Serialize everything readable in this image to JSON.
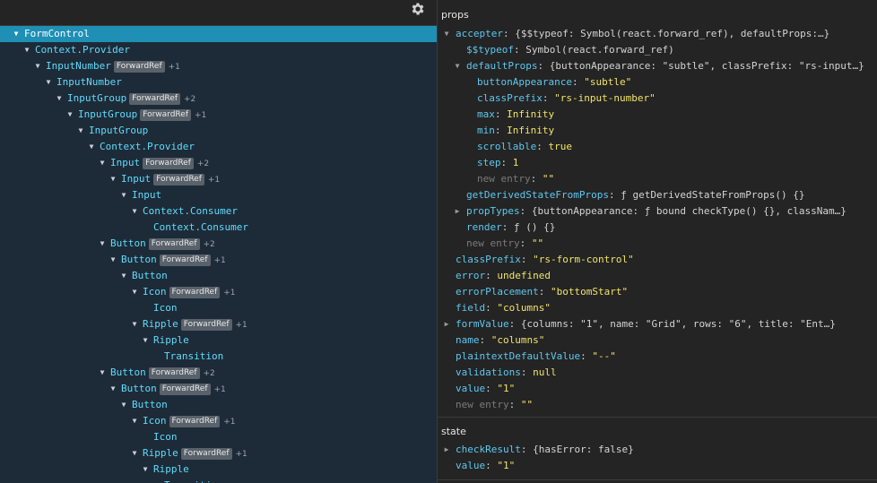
{
  "toolbar": {
    "settings_icon": "gear-icon"
  },
  "tree": [
    {
      "label": "FormControl",
      "depth": 0,
      "expanded": true,
      "selected": true
    },
    {
      "label": "Context.Provider",
      "depth": 1,
      "expanded": true
    },
    {
      "label": "InputNumber",
      "depth": 2,
      "expanded": true,
      "badge": "ForwardRef",
      "count": "+1"
    },
    {
      "label": "InputNumber",
      "depth": 3,
      "expanded": true
    },
    {
      "label": "InputGroup",
      "depth": 4,
      "expanded": true,
      "badge": "ForwardRef",
      "count": "+2"
    },
    {
      "label": "InputGroup",
      "depth": 5,
      "expanded": true,
      "badge": "ForwardRef",
      "count": "+1"
    },
    {
      "label": "InputGroup",
      "depth": 6,
      "expanded": true
    },
    {
      "label": "Context.Provider",
      "depth": 7,
      "expanded": true
    },
    {
      "label": "Input",
      "depth": 8,
      "expanded": true,
      "badge": "ForwardRef",
      "count": "+2"
    },
    {
      "label": "Input",
      "depth": 9,
      "expanded": true,
      "badge": "ForwardRef",
      "count": "+1"
    },
    {
      "label": "Input",
      "depth": 10,
      "expanded": true
    },
    {
      "label": "Context.Consumer",
      "depth": 11,
      "expanded": true
    },
    {
      "label": "Context.Consumer",
      "depth": 12
    },
    {
      "label": "Button",
      "depth": 8,
      "expanded": true,
      "badge": "ForwardRef",
      "count": "+2"
    },
    {
      "label": "Button",
      "depth": 9,
      "expanded": true,
      "badge": "ForwardRef",
      "count": "+1"
    },
    {
      "label": "Button",
      "depth": 10,
      "expanded": true
    },
    {
      "label": "Icon",
      "depth": 11,
      "expanded": true,
      "badge": "ForwardRef",
      "count": "+1"
    },
    {
      "label": "Icon",
      "depth": 12
    },
    {
      "label": "Ripple",
      "depth": 11,
      "expanded": true,
      "badge": "ForwardRef",
      "count": "+1"
    },
    {
      "label": "Ripple",
      "depth": 12,
      "expanded": true
    },
    {
      "label": "Transition",
      "depth": 13
    },
    {
      "label": "Button",
      "depth": 8,
      "expanded": true,
      "badge": "ForwardRef",
      "count": "+2"
    },
    {
      "label": "Button",
      "depth": 9,
      "expanded": true,
      "badge": "ForwardRef",
      "count": "+1"
    },
    {
      "label": "Button",
      "depth": 10,
      "expanded": true
    },
    {
      "label": "Icon",
      "depth": 11,
      "expanded": true,
      "badge": "ForwardRef",
      "count": "+1"
    },
    {
      "label": "Icon",
      "depth": 12
    },
    {
      "label": "Ripple",
      "depth": 11,
      "expanded": true,
      "badge": "ForwardRef",
      "count": "+1"
    },
    {
      "label": "Ripple",
      "depth": 12,
      "expanded": true
    },
    {
      "label": "Transition",
      "depth": 13
    }
  ],
  "props": {
    "title": "props",
    "rows": [
      {
        "depth": 0,
        "toggle": "down",
        "key": "accepter",
        "value": "{$$typeof: Symbol(react.forward_ref), defaultProps:…}",
        "type": "obj"
      },
      {
        "depth": 1,
        "key": "$$typeof",
        "value": "Symbol(react.forward_ref)",
        "type": "obj"
      },
      {
        "depth": 1,
        "toggle": "down",
        "key": "defaultProps",
        "value": "{buttonAppearance: \"subtle\", classPrefix: \"rs-input…}",
        "type": "obj"
      },
      {
        "depth": 2,
        "key": "buttonAppearance",
        "value": "\"subtle\"",
        "type": "str"
      },
      {
        "depth": 2,
        "key": "classPrefix",
        "value": "\"rs-input-number\"",
        "type": "str"
      },
      {
        "depth": 2,
        "key": "max",
        "value": "Infinity",
        "type": "num"
      },
      {
        "depth": 2,
        "key": "min",
        "value": "Infinity",
        "type": "num"
      },
      {
        "depth": 2,
        "key": "scrollable",
        "value": "true",
        "type": "num"
      },
      {
        "depth": 2,
        "key": "step",
        "value": "1",
        "type": "num"
      },
      {
        "depth": 2,
        "key": "new entry",
        "value": "\"\"",
        "type": "str",
        "entry": true
      },
      {
        "depth": 1,
        "key": "getDerivedStateFromProps",
        "value": "ƒ getDerivedStateFromProps() {}",
        "type": "obj"
      },
      {
        "depth": 1,
        "toggle": "right",
        "key": "propTypes",
        "value": "{buttonAppearance: ƒ bound checkType() {}, classNam…}",
        "type": "obj"
      },
      {
        "depth": 1,
        "key": "render",
        "value": "ƒ () {}",
        "type": "obj"
      },
      {
        "depth": 1,
        "key": "new entry",
        "value": "\"\"",
        "type": "str",
        "entry": true
      },
      {
        "depth": 0,
        "key": "classPrefix",
        "value": "\"rs-form-control\"",
        "type": "str"
      },
      {
        "depth": 0,
        "key": "error",
        "value": "undefined",
        "type": "num"
      },
      {
        "depth": 0,
        "key": "errorPlacement",
        "value": "\"bottomStart\"",
        "type": "str"
      },
      {
        "depth": 0,
        "key": "field",
        "value": "\"columns\"",
        "type": "str"
      },
      {
        "depth": 0,
        "toggle": "right",
        "key": "formValue",
        "value": "{columns: \"1\", name: \"Grid\", rows: \"6\", title: \"Ent…}",
        "type": "obj"
      },
      {
        "depth": 0,
        "key": "name",
        "value": "\"columns\"",
        "type": "str"
      },
      {
        "depth": 0,
        "key": "plaintextDefaultValue",
        "value": "\"--\"",
        "type": "str"
      },
      {
        "depth": 0,
        "key": "validations",
        "value": "null",
        "type": "num"
      },
      {
        "depth": 0,
        "key": "value",
        "value": "\"1\"",
        "type": "str"
      },
      {
        "depth": 0,
        "key": "new entry",
        "value": "\"\"",
        "type": "str",
        "entry": true
      }
    ]
  },
  "state": {
    "title": "state",
    "rows": [
      {
        "depth": 0,
        "toggle": "right",
        "key": "checkResult",
        "value": "{hasError: false}",
        "type": "obj"
      },
      {
        "depth": 0,
        "key": "value",
        "value": "\"1\"",
        "type": "str"
      }
    ]
  }
}
